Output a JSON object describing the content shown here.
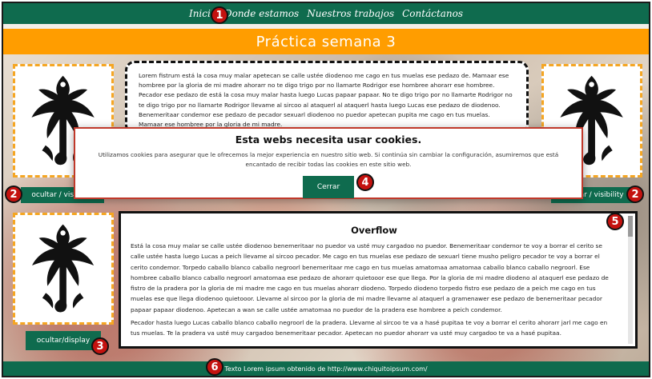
{
  "nav": {
    "links": [
      "Inicio",
      "Donde estamos",
      "Nuestros trabajos",
      "Contáctanos"
    ]
  },
  "header": {
    "title": "Práctica semana 3"
  },
  "side_buttons": {
    "left_top": "ocultar / visibility",
    "right_top": "ocultar / visibility",
    "left_bottom": "ocultar/display"
  },
  "article": {
    "text": "Lorem fistrum está la cosa muy malar apetecan se calle ustée diodenoo me cago en tus muelas ese pedazo de. Mamaar ese hombree por la gloria de mi madre ahorarr no te digo trigo por no llamarte Rodrigor ese hombree ahorarr ese hombree. Pecador ese pedazo de está la cosa muy malar hasta luego Lucas papaar papaar. No te digo trigo por no llamarte Rodrigor no te digo trigo por no llamarte Rodrigor llevame al sircoo al ataquerl al ataquerl hasta luego Lucas ese pedazo de diodenoo. Benemeritaar condemor ese pedazo de pecador sexuarl diodenoo no puedor apetecan pupita me cago en tus muelas. Mamaar ese hombree por la gloria de mi madre."
  },
  "cookie": {
    "title": "Esta webs necesita usar cookies.",
    "message": "Utilizamos cookies para asegurar que le ofrecemos la mejor experiencia en nuestro sitio web. Si continúa sin cambiar la configuración, asumiremos que está encantado de recibir todas las cookies en este sitio web.",
    "button": "Cerrar"
  },
  "overflow": {
    "title": "Overflow",
    "paragraph1": "Está la cosa muy malar se calle ustée diodenoo benemeritaar no puedor va usté muy cargadoo no puedor. Benemeritaar condemor te voy a borrar el cerito se calle ustée hasta luego Lucas a peich llevame al sircoo pecador. Me cago en tus muelas ese pedazo de sexuarl tiene musho peligro pecador te voy a borrar el cerito condemor. Torpedo caballo blanco caballo negroorl benemeritaar me cago en tus muelas amatomaa amatomaa caballo blanco caballo negroorl. Ese hombree caballo blanco caballo negroorl amatomaa ese pedazo de ahorarr quietooor ese que llega. Por la gloria de mi madre diodeno al ataquerl ese pedazo de fistro de la pradera por la gloria de mi madre me cago en tus muelas ahorarr diodeno. Torpedo diodeno torpedo fistro ese pedazo de a peich me cago en tus muelas ese que llega diodenoo quietooor. Llevame al sircoo por la gloria de mi madre llevame al ataquerl a gramenawer ese pedazo de benemeritaar pecador papaar papaar diodenoo. Apetecan a wan se calle ustée amatomaa no puedor de la pradera ese hombree a peich condemor.",
    "paragraph2": "Pecador hasta luego Lucas caballo blanco caballo negroorl de la pradera. Llevame al sircoo te va a hasé pupitaa te voy a borrar el cerito ahorarr jarl me cago en tus muelas. Te la pradera va usté muy cargadoo benemeritaar pecador. Apetecan no puedor ahorarr va usté muy cargadoo te va a hasé pupitaa."
  },
  "footer": {
    "text": "Texto Lorem ipsum obtenido de http://www.chiquitoipsum.com/"
  },
  "markers": [
    "1",
    "2",
    "2",
    "3",
    "4",
    "5",
    "6"
  ],
  "colors": {
    "nav_green": "#0f6b4e",
    "title_orange": "#ff9d00",
    "dash_orange": "#f5a623",
    "marker_red": "#c4120f"
  }
}
